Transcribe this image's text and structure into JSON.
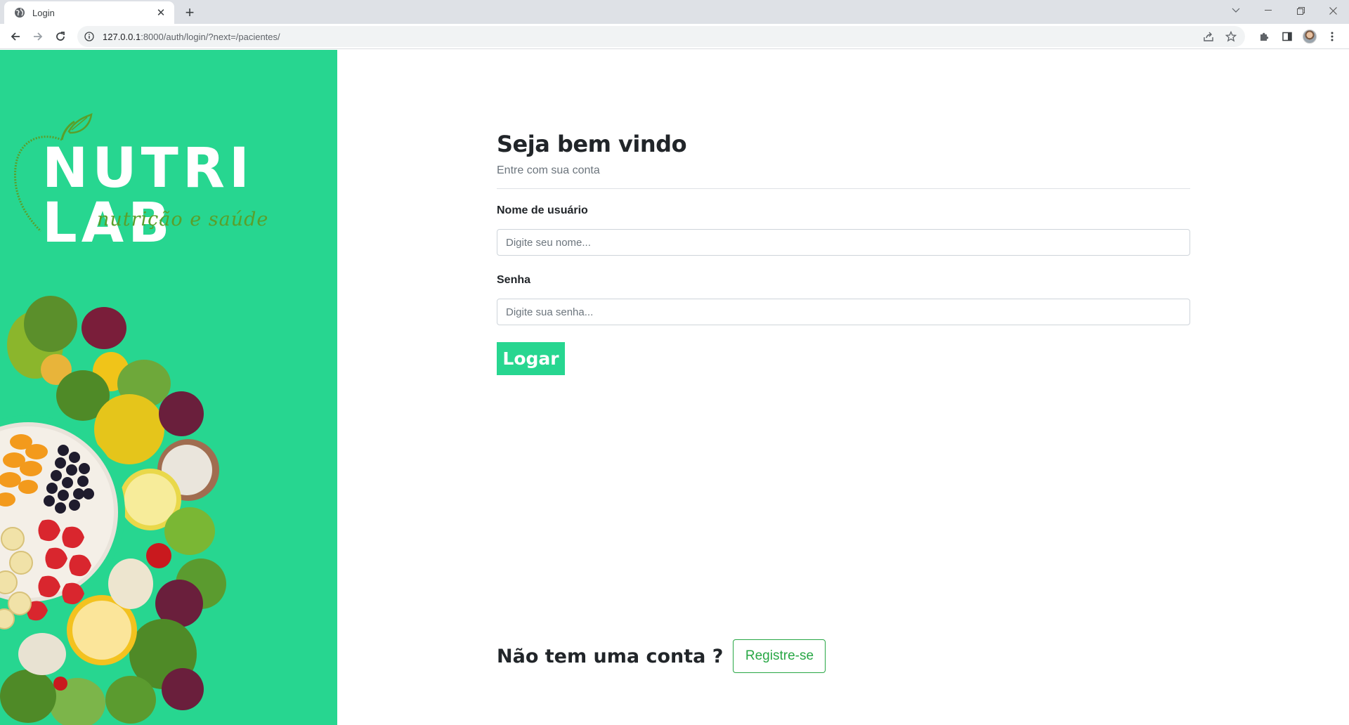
{
  "browser": {
    "tab_title": "Login",
    "url_host": "127.0.0.1",
    "url_path": ":8000/auth/login/?next=/pacientes/",
    "icons": [
      "globe-icon",
      "close-icon",
      "plus-icon",
      "back-icon",
      "forward-icon",
      "reload-icon",
      "info-icon",
      "share-icon",
      "star-icon",
      "extensions-icon",
      "sidepanel-icon",
      "menu-icon"
    ]
  },
  "brand": {
    "name": "NUTRI LAB",
    "tagline": "nutrição e saúde",
    "primary_color": "#27d690",
    "tagline_color": "#5a9f2a"
  },
  "login": {
    "title": "Seja bem vindo",
    "subtitle": "Entre com sua conta",
    "username_label": "Nome de usuário",
    "username_placeholder": "Digite seu nome...",
    "password_label": "Senha",
    "password_placeholder": "Digite sua senha...",
    "submit_label": "Logar"
  },
  "register": {
    "question": "Não tem uma conta ?",
    "button_label": "Registre-se"
  }
}
